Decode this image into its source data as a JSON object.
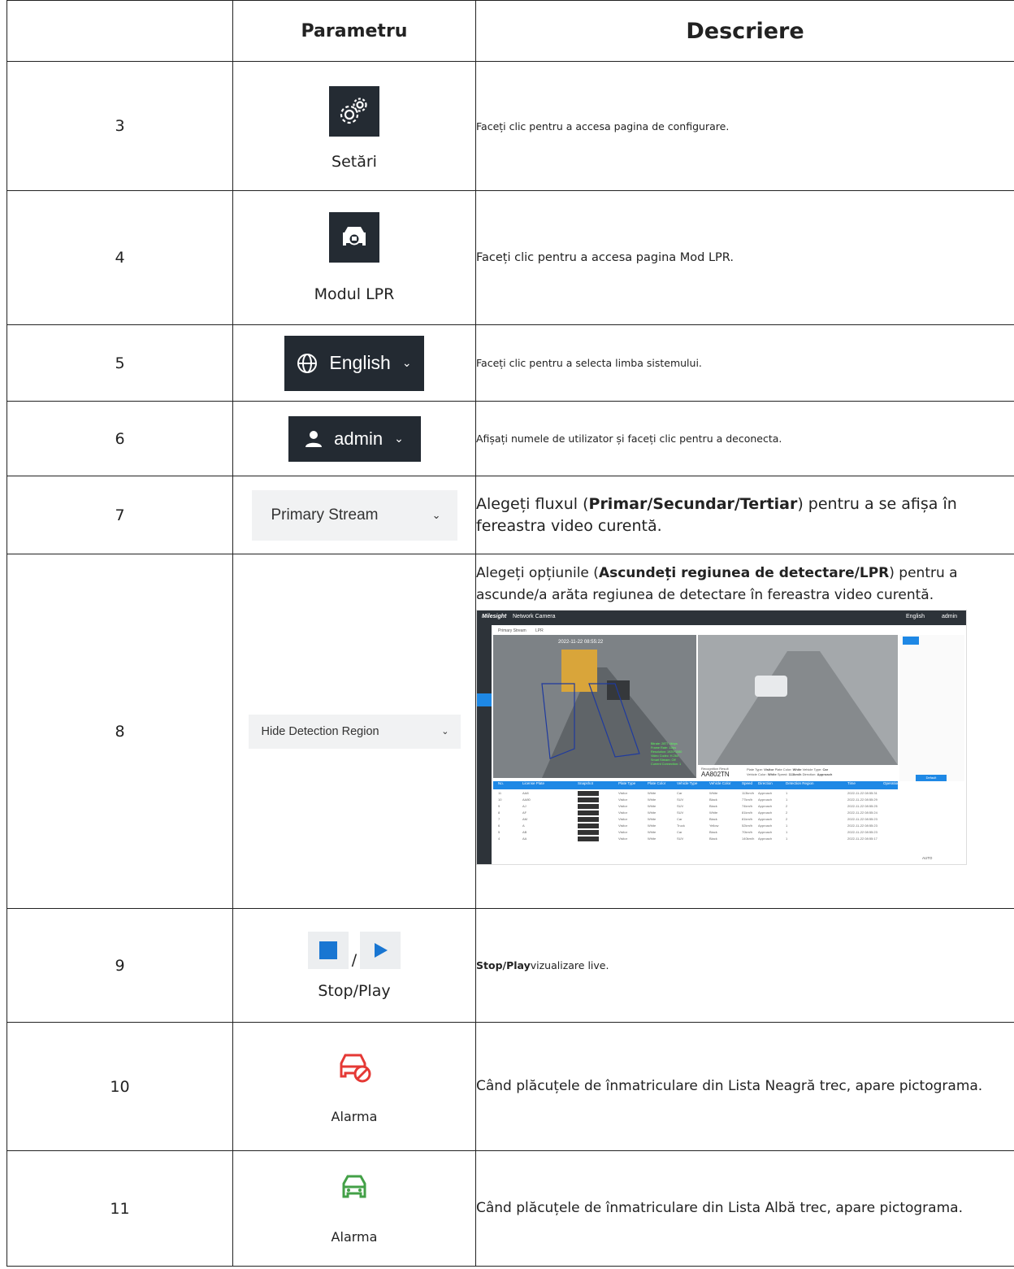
{
  "header": {
    "col_no": "",
    "col_param": "Parametru",
    "col_desc": "Descriere"
  },
  "rows": [
    {
      "no": "3",
      "param_label": "Setări",
      "icon": "gears-icon",
      "desc": "Faceți clic pentru a accesa pagina de configurare."
    },
    {
      "no": "4",
      "param_label": "Modul LPR",
      "icon": "car-search-icon",
      "desc": "Faceți clic pentru a accesa pagina Mod LPR."
    },
    {
      "no": "5",
      "param_label": "English",
      "icon": "globe-icon",
      "desc": "Faceți clic pentru a selecta limba sistemului."
    },
    {
      "no": "6",
      "param_label": "admin",
      "icon": "user-icon",
      "desc": "Afișați numele de utilizator și faceți clic pentru a deconecta."
    },
    {
      "no": "7",
      "param_label": "Primary Stream",
      "desc_prefix": "Alegeți fluxul (",
      "desc_bold": "Primar/Secundar/Tertiar",
      "desc_suffix": ") pentru a se afișa în fereastra video curentă."
    },
    {
      "no": "8",
      "param_label": "Hide Detection Region",
      "desc_prefix": "Alegeți opțiunile (",
      "desc_bold": "Ascundeți regiunea de detectare/LPR",
      "desc_suffix": ") pentru a ascunde/a arăta regiunea de detectare în fereastra video curentă."
    },
    {
      "no": "9",
      "param_sep": "/",
      "param_label": "Stop/Play",
      "desc_bold": "Stop/Play",
      "desc_suffix": "vizualizare live."
    },
    {
      "no": "10",
      "param_label": "Alarma",
      "icon": "car-blacklist-icon",
      "desc": "Când plăcuțele de înmatriculare din Lista Neagră trec, apare pictograma."
    },
    {
      "no": "11",
      "param_label": "Alarma",
      "icon": "car-whitelist-icon",
      "desc": "Când plăcuțele de înmatriculare din Lista Albă trec, apare pictograma."
    }
  ],
  "screenshot": {
    "brand": "Milesight",
    "title": "Network Camera",
    "language": "English",
    "user": "admin",
    "stream_select": "Primary Stream",
    "mode_select": "LPR",
    "timestamp": "2022-11-22 08:55:22",
    "overlay_lines": [
      "Bitrate: 2877 4kbps",
      "Frame Rate: 11fps",
      "Resolution: 1920*1080",
      "Video Codec: H.264",
      "Smart Stream: Off",
      "Current Connection: 1"
    ],
    "recognition_label": "Recognition Result",
    "plate": "AA802TN",
    "plate_type_label": "Plate Type:",
    "plate_type": "Visitor",
    "plate_color_label": "Plate Color:",
    "plate_color": "White",
    "vehicle_type_label": "Vehicle Type:",
    "vehicle_type": "Car",
    "vehicle_color_label": "Vehicle Color:",
    "vehicle_color": "White",
    "speed_label": "Speed:",
    "speed": "113km/h",
    "direction_label": "Direction:",
    "direction": "Approach",
    "default_button": "Default",
    "columns": [
      "No.",
      "License Plate",
      "Snapshot",
      "Plate Type",
      "Plate Color",
      "Vehicle Type",
      "Vehicle Color",
      "Speed",
      "Direction",
      "Detection Region",
      "Time",
      "Operation"
    ],
    "table_rows": [
      [
        "11",
        "AA8",
        "",
        "Visitor",
        "White",
        "Car",
        "White",
        "113km/h",
        "Approach",
        "1",
        "2022-11-22 08:55:31"
      ],
      [
        "10",
        "AA80",
        "",
        "Visitor",
        "White",
        "SUV",
        "Black",
        "77km/h",
        "Approach",
        "1",
        "2022-11-22 08:55:29"
      ],
      [
        "9",
        "AJ",
        "",
        "Visitor",
        "White",
        "SUV",
        "Black",
        "74km/h",
        "Approach",
        "2",
        "2022-11-22 08:55:25"
      ],
      [
        "8",
        "AF",
        "",
        "Visitor",
        "White",
        "SUV",
        "White",
        "81km/h",
        "Approach",
        "2",
        "2022-11-22 08:55:24"
      ],
      [
        "7",
        "AM",
        "",
        "Visitor",
        "White",
        "Car",
        "Black",
        "81km/h",
        "Approach",
        "2",
        "2022-11-22 08:55:23"
      ],
      [
        "6",
        "A",
        "",
        "Visitor",
        "White",
        "Truck",
        "Yellow",
        "52km/h",
        "Approach",
        "1",
        "2022-11-22 08:55:23"
      ],
      [
        "5",
        "AB",
        "",
        "Visitor",
        "White",
        "Car",
        "Black",
        "70km/h",
        "Approach",
        "1",
        "2022-11-22 08:55:23"
      ],
      [
        "4",
        "AA",
        "",
        "Visitor",
        "White",
        "SUV",
        "Black",
        "140km/h",
        "Approach",
        "1",
        "2022-11-22 08:55:17"
      ]
    ],
    "footer_auto": "AUTO"
  }
}
